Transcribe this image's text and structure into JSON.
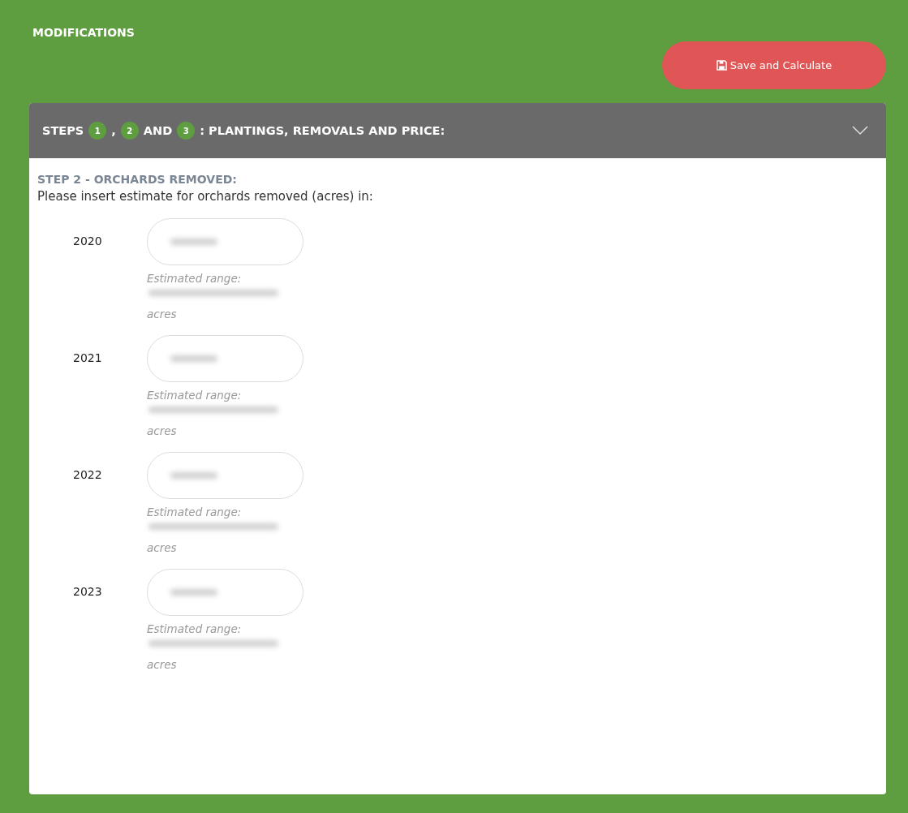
{
  "section_title": "MODIFICATIONS",
  "save_button": {
    "label": "Save and Calculate"
  },
  "accordion": {
    "expanded": true,
    "title_parts": [
      {
        "kind": "text",
        "text": "STEPS"
      },
      {
        "kind": "badge",
        "text": "1"
      },
      {
        "kind": "text",
        "text": ","
      },
      {
        "kind": "badge",
        "text": "2"
      },
      {
        "kind": "text",
        "text": "AND"
      },
      {
        "kind": "badge",
        "text": "3"
      },
      {
        "kind": "text",
        "text": ": PLANTINGS, REMOVALS AND PRICE:"
      }
    ]
  },
  "step": {
    "heading": "STEP 2 - ORCHARDS REMOVED:",
    "instruction": "Please insert estimate for orchards removed (acres) in:",
    "years": [
      {
        "year": "2020",
        "range_label": "Estimated range:",
        "unit": "acres"
      },
      {
        "year": "2021",
        "range_label": "Estimated range:",
        "unit": "acres"
      },
      {
        "year": "2022",
        "range_label": "Estimated range:",
        "unit": "acres"
      },
      {
        "year": "2023",
        "range_label": "Estimated range:",
        "unit": "acres"
      }
    ]
  }
}
